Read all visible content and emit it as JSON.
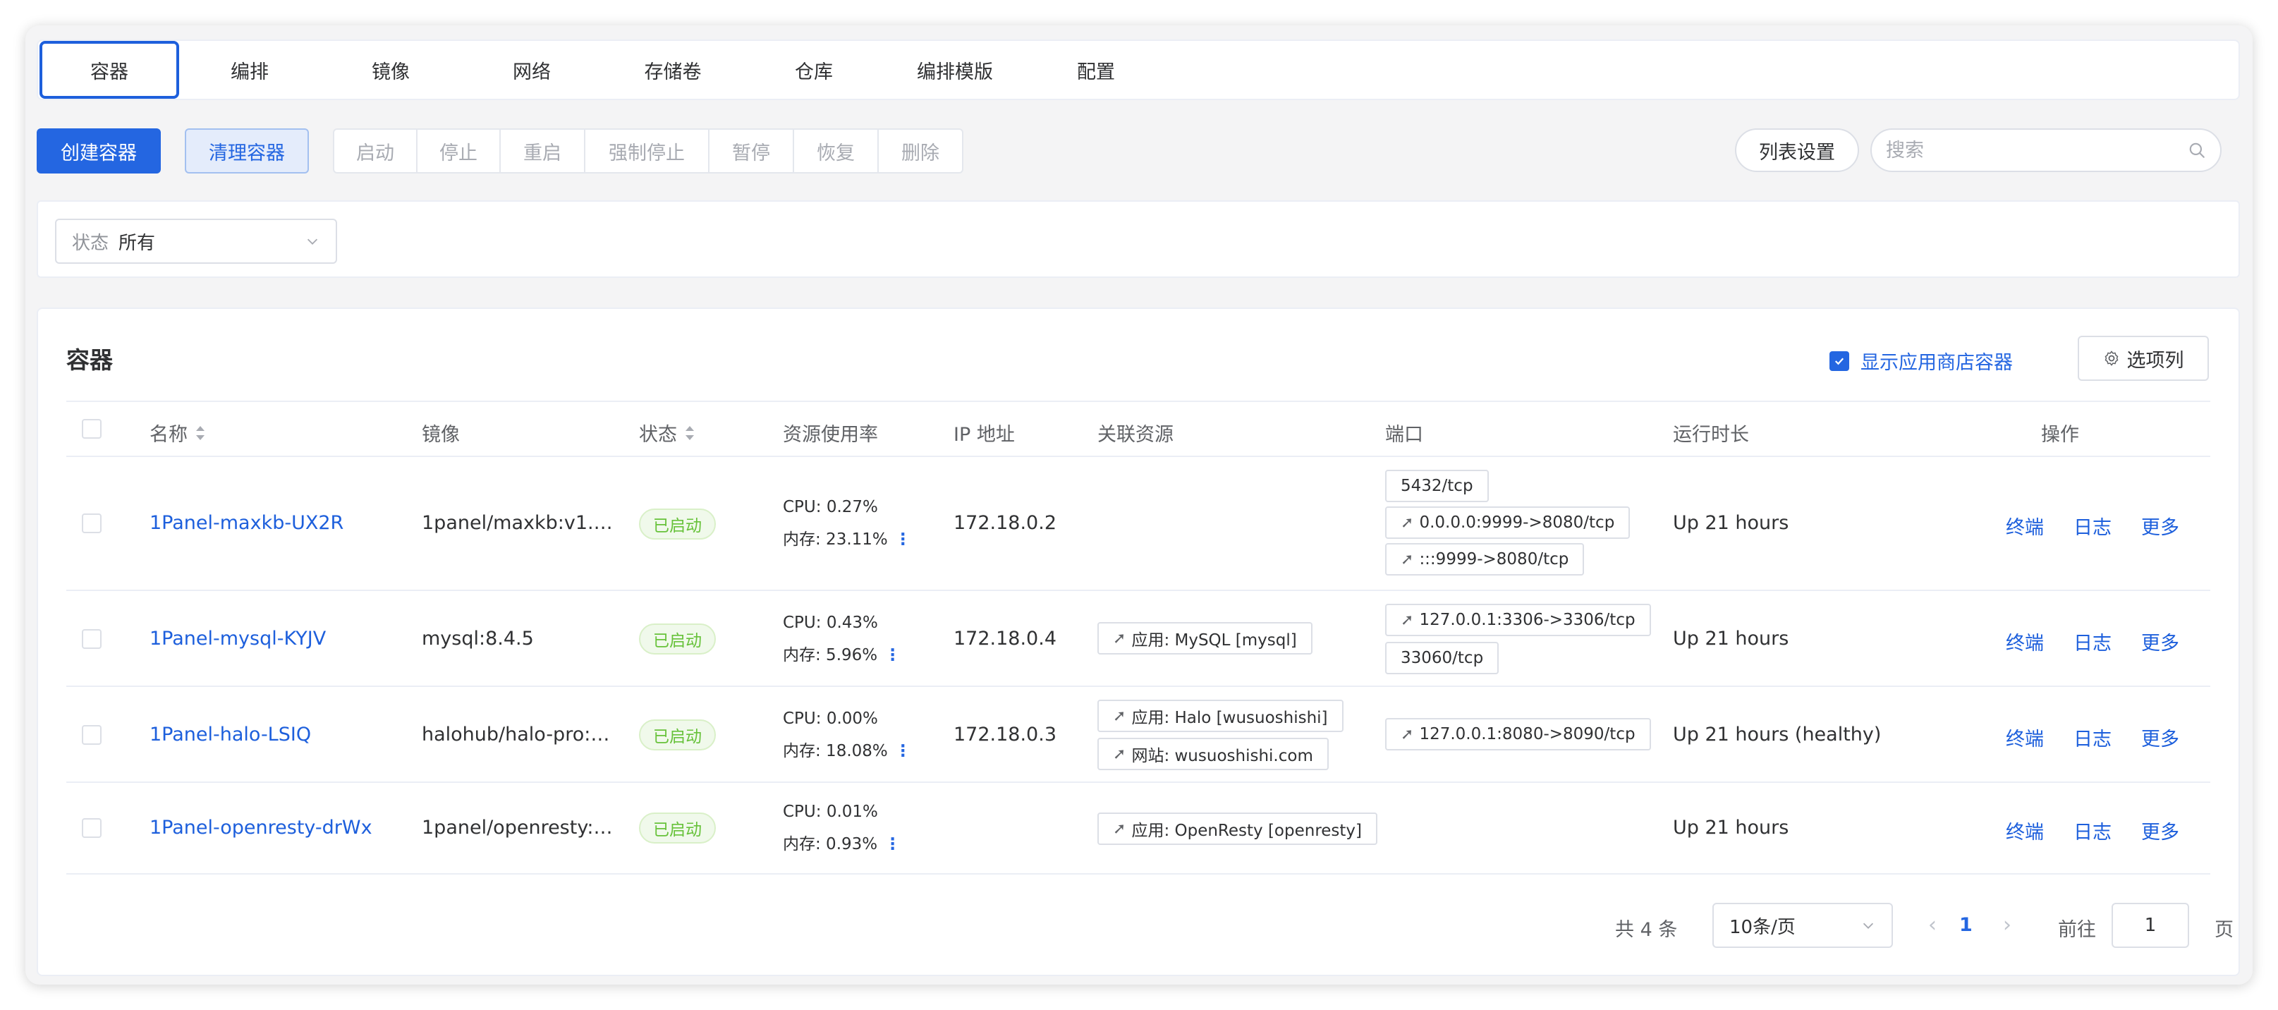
{
  "tabs": [
    {
      "label": "容器",
      "active": true
    },
    {
      "label": "编排"
    },
    {
      "label": "镜像"
    },
    {
      "label": "网络"
    },
    {
      "label": "存储卷"
    },
    {
      "label": "仓库"
    },
    {
      "label": "编排模版"
    },
    {
      "label": "配置"
    }
  ],
  "toolbar": {
    "create": "创建容器",
    "clean": "清理容器",
    "group": [
      "启动",
      "停止",
      "重启",
      "强制停止",
      "暂停",
      "恢复",
      "删除"
    ],
    "list_settings": "列表设置",
    "search_placeholder": "搜索"
  },
  "filter": {
    "status_prefix": "状态",
    "status_value": "所有"
  },
  "panel": {
    "title": "容器",
    "show_store": "显示应用商店容器",
    "options": "选项列"
  },
  "columns": {
    "name": "名称",
    "image": "镜像",
    "status": "状态",
    "resource": "资源使用率",
    "ip": "IP 地址",
    "related": "关联资源",
    "ports": "端口",
    "uptime": "运行时长",
    "ops": "操作"
  },
  "rows": [
    {
      "name": "1Panel-maxkb-UX2R",
      "image": "1panel/maxkb:v1.…",
      "status": "已启动",
      "cpu": "CPU: 0.27%",
      "mem": "内存: 23.11%",
      "ip": "172.18.0.2",
      "related": [],
      "ports": [
        "5432/tcp",
        "0.0.0.0:9999->8080/tcp",
        ":::9999->8080/tcp"
      ],
      "uptime": "Up 21 hours"
    },
    {
      "name": "1Panel-mysql-KYJV",
      "image": "mysql:8.4.5",
      "status": "已启动",
      "cpu": "CPU: 0.43%",
      "mem": "内存: 5.96%",
      "ip": "172.18.0.4",
      "related": [
        "应用: MySQL [mysql]"
      ],
      "ports": [
        "127.0.0.1:3306->3306/tcp",
        "33060/tcp"
      ],
      "uptime": "Up 21 hours"
    },
    {
      "name": "1Panel-halo-LSIQ",
      "image": "halohub/halo-pro:…",
      "status": "已启动",
      "cpu": "CPU: 0.00%",
      "mem": "内存: 18.08%",
      "ip": "172.18.0.3",
      "related": [
        "应用: Halo [wusuoshishi]",
        "网站: wusuoshishi.com"
      ],
      "ports": [
        "127.0.0.1:8080->8090/tcp"
      ],
      "uptime": "Up 21 hours (healthy)"
    },
    {
      "name": "1Panel-openresty-drWx",
      "image": "1panel/openresty:…",
      "status": "已启动",
      "cpu": "CPU: 0.01%",
      "mem": "内存: 0.93%",
      "ip": "",
      "related": [
        "应用: OpenResty [openresty]"
      ],
      "ports": [],
      "uptime": "Up 21 hours"
    }
  ],
  "ops": [
    "终端",
    "日志",
    "更多"
  ],
  "pagination": {
    "total": "共 4 条",
    "page_size": "10条/页",
    "current": "1",
    "goto_label": "前往",
    "goto_value": "1",
    "page_suffix": "页"
  },
  "colors": {
    "primary": "#2466e1",
    "link": "#1d5fdc",
    "success": "#67c23a"
  }
}
